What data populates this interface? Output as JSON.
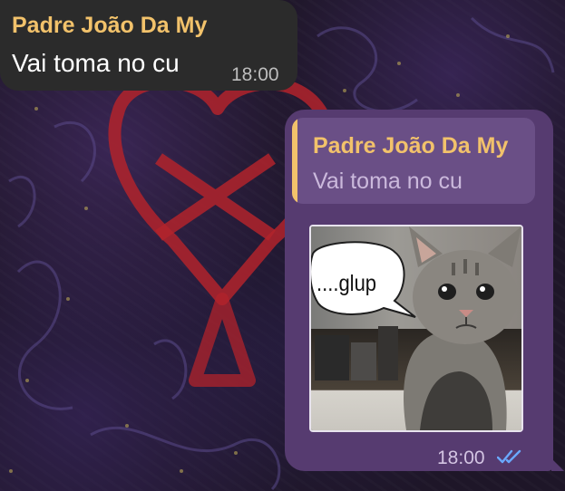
{
  "incoming_message": {
    "sender": "Padre João Da My",
    "text": "Vai toma no cu",
    "time": "18:00"
  },
  "outgoing_message": {
    "reply_to": {
      "sender": "Padre João Da My",
      "text": "Vai toma no cu"
    },
    "sticker": {
      "speech_text": "....glup",
      "icon": "cat-sticker-image"
    },
    "time": "18:00",
    "status_icon": "double-check-read-icon"
  },
  "colors": {
    "sender_name": "#f2c26b",
    "incoming_bubble": "#2b2b2b",
    "outgoing_bubble": "#563b70",
    "reply_block": "#6a4f86",
    "read_checks": "#6aa9ff"
  }
}
